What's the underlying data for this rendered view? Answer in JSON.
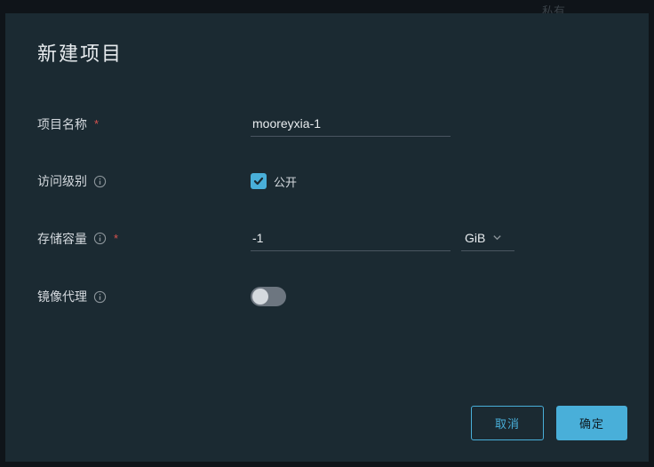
{
  "background_text": "私有",
  "modal": {
    "title": "新建项目",
    "fields": {
      "project_name": {
        "label": "项目名称",
        "value": "mooreyxia-1"
      },
      "access_level": {
        "label": "访问级别",
        "checkbox_label": "公开"
      },
      "storage_quota": {
        "label": "存储容量",
        "value": "-1",
        "unit": "GiB"
      },
      "mirror_proxy": {
        "label": "镜像代理"
      }
    },
    "actions": {
      "cancel": "取消",
      "confirm": "确定"
    }
  }
}
